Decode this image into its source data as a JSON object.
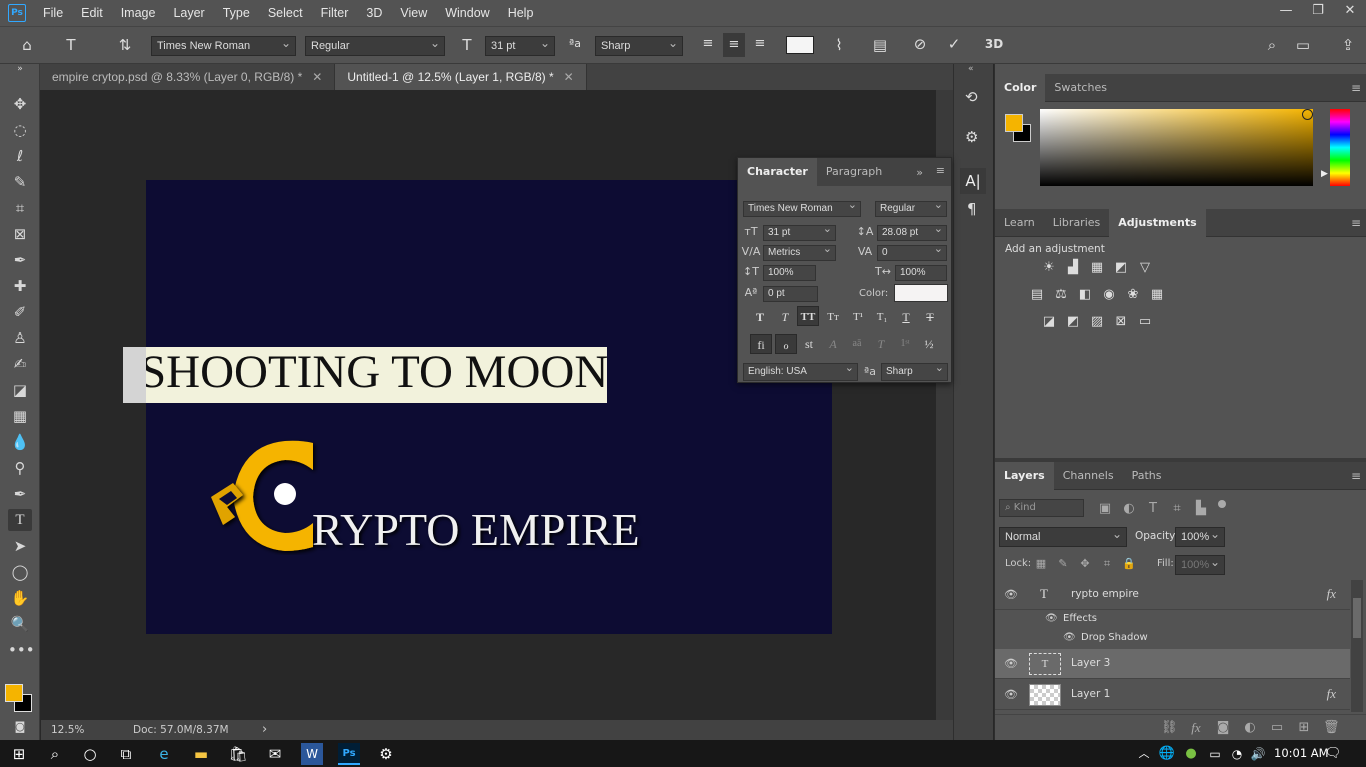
{
  "app": {
    "logo": "Ps",
    "window_controls": [
      "—",
      "❐",
      "✕"
    ]
  },
  "menu": [
    "File",
    "Edit",
    "Image",
    "Layer",
    "Type",
    "Select",
    "Filter",
    "3D",
    "View",
    "Window",
    "Help"
  ],
  "options_bar": {
    "font_family": "Times New Roman",
    "font_style": "Regular",
    "font_size": "31 pt",
    "antialias": "Sharp",
    "aa_label": "ªa",
    "label_3d": "3D"
  },
  "tabs": [
    {
      "label": "empire crytop.psd @ 8.33% (Layer 0, RGB/8) *",
      "close": "✕"
    },
    {
      "label": "Untitled-1 @ 12.5% (Layer 1, RGB/8) *",
      "close": "✕"
    }
  ],
  "canvas": {
    "headline": "SHOOTING TO MOON",
    "logo_text": "RYPTO EMPIRE"
  },
  "status": {
    "zoom": "12.5%",
    "doc": "Doc: 57.0M/8.37M",
    "arrow": "›"
  },
  "character_panel": {
    "tabs": [
      "Character",
      "Paragraph"
    ],
    "font_family": "Times New Roman",
    "font_style": "Regular",
    "size": "31 pt",
    "leading": "28.08 pt",
    "kerning": "Metrics",
    "tracking": "0",
    "vscale": "100%",
    "hscale": "100%",
    "baseline": "0 pt",
    "color_label": "Color:",
    "language": "English: USA",
    "antialias": "Sharp"
  },
  "color_panel": {
    "tabs": [
      "Color",
      "Swatches"
    ],
    "fg": "#f5b400",
    "bg": "#000000"
  },
  "adjust_panel": {
    "tabs": [
      "Learn",
      "Libraries",
      "Adjustments"
    ],
    "hint": "Add an adjustment"
  },
  "layers_panel": {
    "tabs": [
      "Layers",
      "Channels",
      "Paths"
    ],
    "search": "Kind",
    "blend": "Normal",
    "opacity_label": "Opacity:",
    "opacity": "100%",
    "lock_label": "Lock:",
    "fill_label": "Fill:",
    "fill": "100%",
    "layers": [
      {
        "name": "rypto empire",
        "type": "text",
        "fx": "fx"
      },
      {
        "name": "Effects",
        "type": "sub"
      },
      {
        "name": "Drop Shadow",
        "type": "sub2"
      },
      {
        "name": "Layer 3",
        "type": "text"
      },
      {
        "name": "Layer 1",
        "type": "pixel",
        "fx": "fx"
      }
    ]
  },
  "taskbar": {
    "time": "10:01 AM"
  },
  "colors": {
    "accent": "#31a8ff",
    "artboard": "#0d0c33",
    "logo_yellow": "#f5b400"
  }
}
